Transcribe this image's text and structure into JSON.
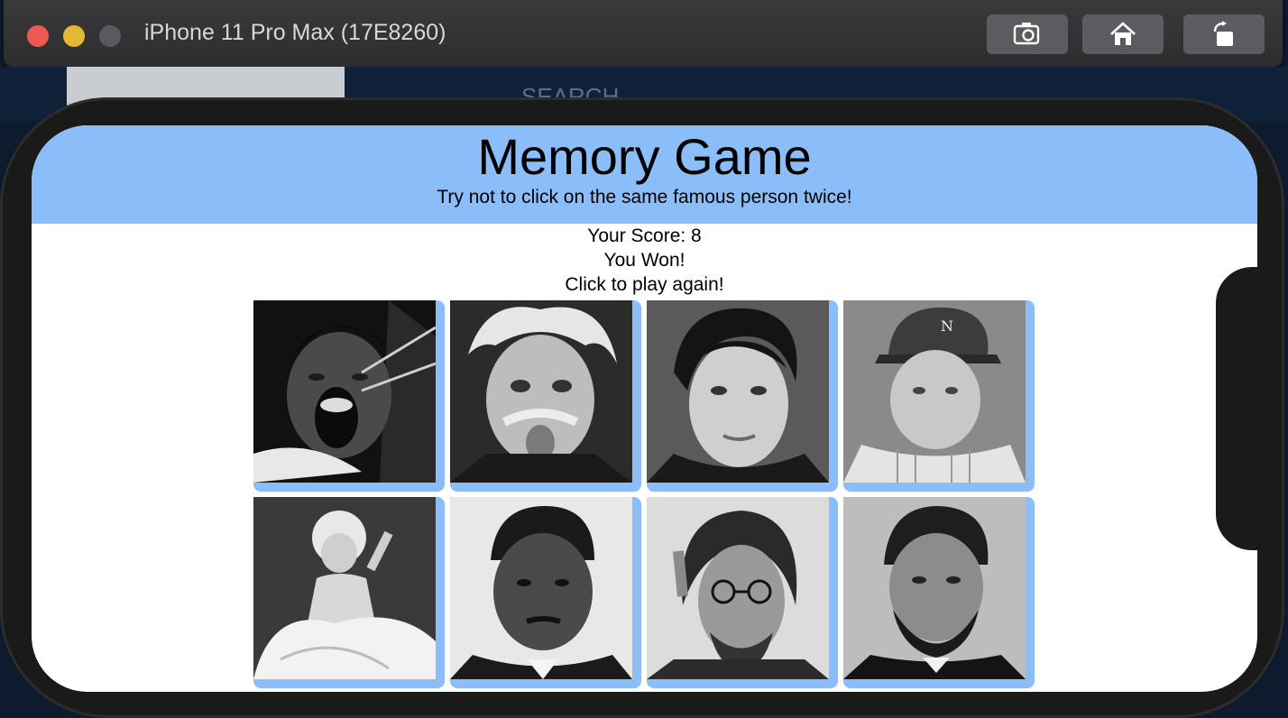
{
  "window": {
    "title": "iPhone 11 Pro Max (17E8260)"
  },
  "toolbar": {
    "screenshot_icon": "camera-icon",
    "home_icon": "home-icon",
    "rotate_icon": "rotate-icon"
  },
  "background_app": {
    "search_label": "SEARCH"
  },
  "game": {
    "title": "Memory Game",
    "subtitle": "Try not to click on the same famous person twice!",
    "score_line": "Your Score: 8",
    "result_line": "You Won!",
    "prompt_line": "Click to play again!"
  },
  "cards": [
    {
      "subject": "boxer-portrait"
    },
    {
      "subject": "physicist-tongue-portrait"
    },
    {
      "subject": "singer-portrait"
    },
    {
      "subject": "baseball-player-portrait"
    },
    {
      "subject": "actress-white-dress-portrait"
    },
    {
      "subject": "civil-rights-leader-portrait"
    },
    {
      "subject": "musician-round-glasses-portrait"
    },
    {
      "subject": "president-beard-portrait"
    }
  ],
  "colors": {
    "accent": "#8bbef9",
    "phone_bezel": "#1a1a1a",
    "titlebar": "#333335"
  }
}
